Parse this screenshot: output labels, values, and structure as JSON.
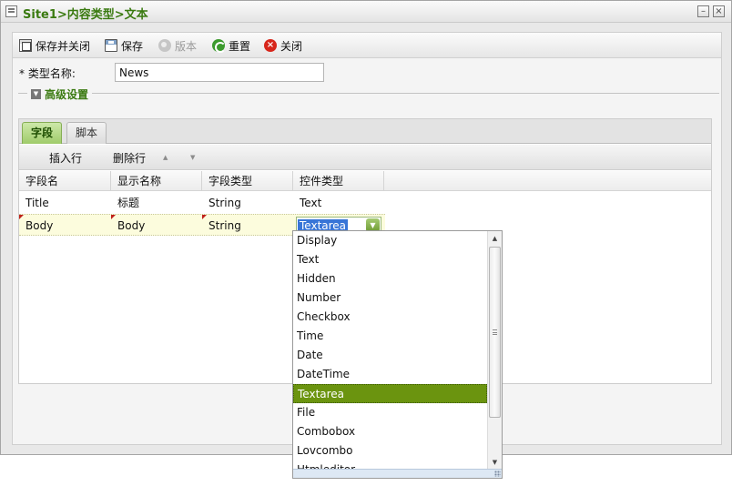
{
  "window": {
    "title": "Site1>内容类型>文本"
  },
  "toolbar": {
    "save_close_label": "保存并关闭",
    "save_label": "保存",
    "version_label": "版本",
    "reset_label": "重置",
    "close_label": "关闭"
  },
  "form": {
    "type_name_label": "* 类型名称:",
    "type_name_value": "News",
    "advanced_label": "高级设置"
  },
  "tabs": [
    {
      "label": "字段",
      "active": true
    },
    {
      "label": "脚本",
      "active": false
    }
  ],
  "grid_toolbar": {
    "insert_row_label": "插入行",
    "delete_row_label": "删除行"
  },
  "grid": {
    "columns": [
      "字段名",
      "显示名称",
      "字段类型",
      "控件类型"
    ],
    "rows": [
      {
        "field": "Title",
        "display": "标题",
        "type": "String",
        "control": "Text"
      },
      {
        "field": "Body",
        "display": "Body",
        "type": "String",
        "control": "Textarea"
      }
    ]
  },
  "dropdown": {
    "items": [
      "Display",
      "Text",
      "Hidden",
      "Number",
      "Checkbox",
      "Time",
      "Date",
      "DateTime",
      "Textarea",
      "File",
      "Combobox",
      "Lovcombo",
      "Htmleditor"
    ],
    "selected": "Textarea"
  },
  "colors": {
    "accent": "#3a7a10",
    "selected_item": "#6b940f",
    "active_tab": "#9fcb6a",
    "text_selection": "#3875d7"
  }
}
